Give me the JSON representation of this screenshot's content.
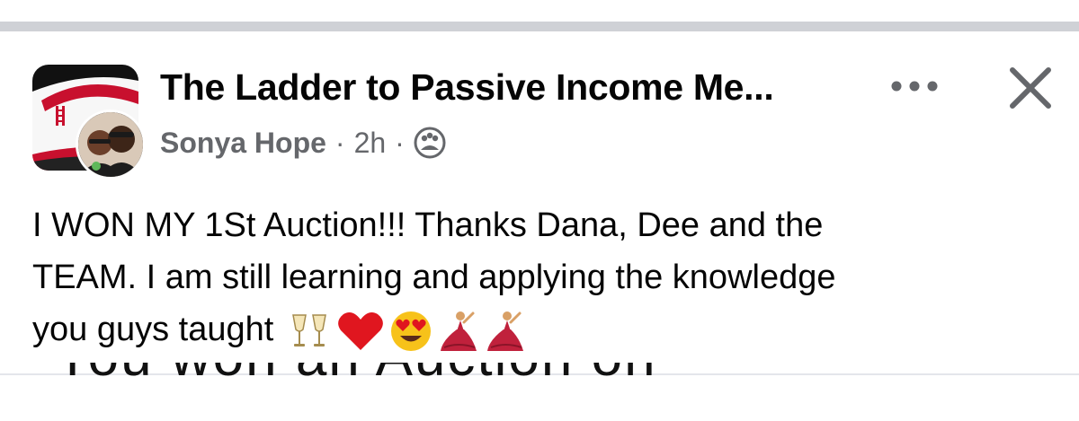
{
  "post": {
    "group_name": "The Ladder to Passive Income Me...",
    "author": "Sonya Hope",
    "separator": "·",
    "timestamp": "2h",
    "privacy_icon": "group-members-icon",
    "text_lines": [
      "I WON MY 1St Auction!!!  Thanks Dana, Dee and the",
      "TEAM.  I am still learning and applying the knowledge",
      "you guys taught"
    ],
    "emojis": [
      "clinking-glasses-icon",
      "red-heart-icon",
      "heart-eyes-icon",
      "dancer-icon",
      "dancer-icon"
    ],
    "next_image_text": "You won an Auction on"
  },
  "actions": {
    "more_icon": "more-options-icon",
    "close_icon": "close-icon"
  },
  "colors": {
    "text_primary": "#050505",
    "text_secondary": "#65676b",
    "top_bar": "#cfd1d6"
  }
}
